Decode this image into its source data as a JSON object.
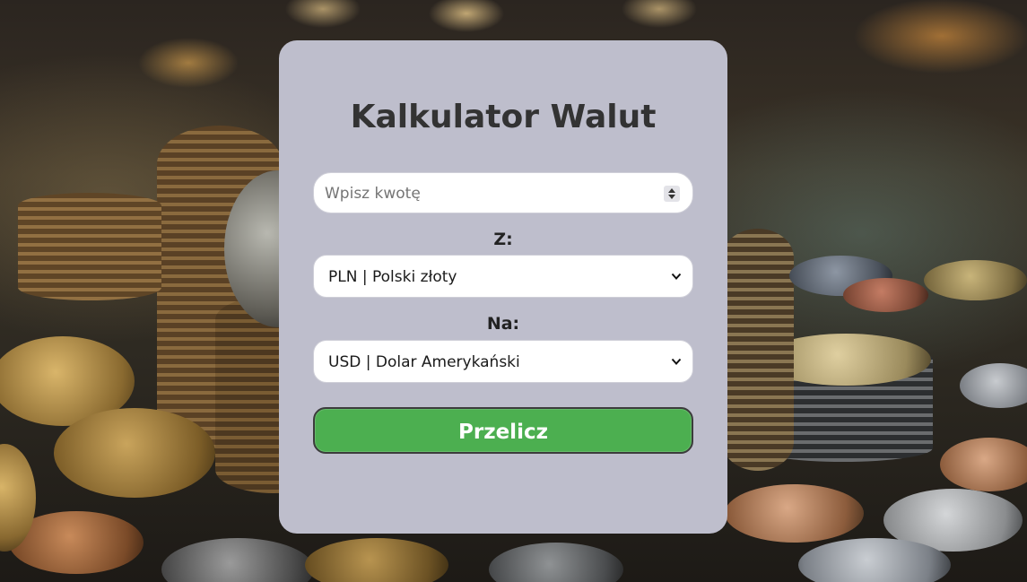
{
  "calculator": {
    "title": "Kalkulator Walut",
    "amount_placeholder": "Wpisz kwotę",
    "from_label": "Z:",
    "from_selected": "PLN | Polski złoty",
    "to_label": "Na:",
    "to_selected": "USD | Dolar Amerykański",
    "convert_label": "Przelicz"
  },
  "colors": {
    "card_background": "#bebecc",
    "button_green": "#4caf50",
    "title_text": "#333333"
  },
  "icons": {
    "amount_spinner": "spinner-icon",
    "from_dropdown": "chevron-down-icon",
    "to_dropdown": "chevron-down-icon"
  }
}
